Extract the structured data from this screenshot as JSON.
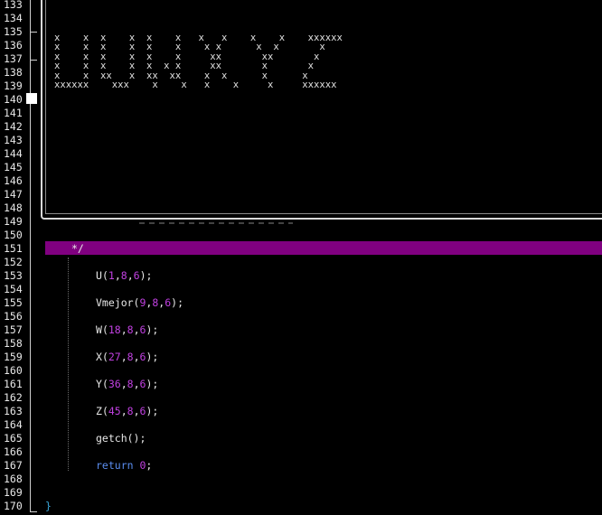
{
  "line_numbers": [
    "133",
    "134",
    "135",
    "136",
    "137",
    "138",
    "139",
    "140",
    "141",
    "142",
    "143",
    "144",
    "145",
    "146",
    "147",
    "148",
    "149",
    "150",
    "151",
    "152",
    "153",
    "154",
    "155",
    "156",
    "157",
    "158",
    "159",
    "160",
    "161",
    "162",
    "163",
    "164",
    "165",
    "166",
    "167",
    "168",
    "169",
    "170"
  ],
  "console": {
    "ascii_art": "x    x  x    x  x    x   x   x    x    x    xxxxxx\nx    x  x    x  x    x    x x      x  x       x\nx    x  x    x  x    x     xx       xx       x\nx    x  x    x  x  x x     xx       x       x\nx    x  xx   x  xx  xx    x  x      x      x\nxxxxxx    xxx    x    x   x    x     x     xxxxxx"
  },
  "code": {
    "comment_end": "*/",
    "calls": [
      {
        "name": "U",
        "args": [
          "1",
          "8",
          "6"
        ],
        "line": 153
      },
      {
        "name": "Vmejor",
        "args": [
          "9",
          "8",
          "6"
        ],
        "line": 155
      },
      {
        "name": "W",
        "args": [
          "18",
          "8",
          "6"
        ],
        "line": 157
      },
      {
        "name": "X",
        "args": [
          "27",
          "8",
          "6"
        ],
        "line": 159
      },
      {
        "name": "Y",
        "args": [
          "36",
          "8",
          "6"
        ],
        "line": 161
      },
      {
        "name": "Z",
        "args": [
          "45",
          "8",
          "6"
        ],
        "line": 163
      }
    ],
    "getch": "getch();",
    "return_kw": "return",
    "return_val": "0",
    "close_brace": "}"
  },
  "colors": {
    "highlight_line": "#800080",
    "number": "#c040e0",
    "keyword": "#5a8df0",
    "brace": "#3aa6d8"
  }
}
